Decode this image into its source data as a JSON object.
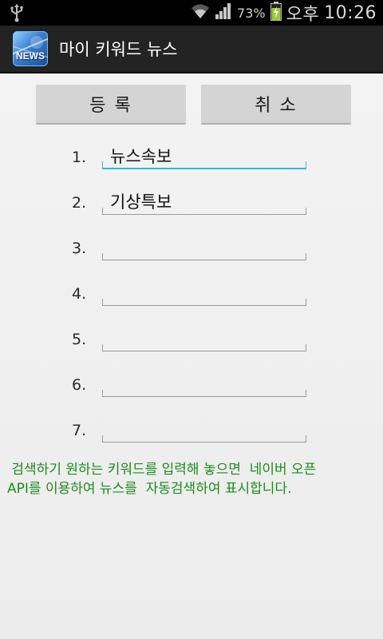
{
  "status_bar": {
    "battery_percent": "73%",
    "am_pm": "오후",
    "time": "10:26",
    "icons": [
      "usb-icon",
      "wifi-icon",
      "signal-icon",
      "battery-charging-icon"
    ]
  },
  "action_bar": {
    "app_icon_text": "NEWS",
    "title": "마이 키워드 뉴스"
  },
  "buttons": {
    "register": "등 록",
    "cancel": "취 소"
  },
  "keywords": [
    {
      "number": "1.",
      "value": "뉴스속보",
      "focused": true
    },
    {
      "number": "2.",
      "value": "기상특보",
      "focused": false
    },
    {
      "number": "3.",
      "value": "",
      "focused": false
    },
    {
      "number": "4.",
      "value": "",
      "focused": false
    },
    {
      "number": "5.",
      "value": "",
      "focused": false
    },
    {
      "number": "6.",
      "value": "",
      "focused": false
    },
    {
      "number": "7.",
      "value": "",
      "focused": false
    }
  ],
  "note": {
    "line1": " 검색하기 원하는 키워드를 입력해 놓으면  네이버 오픈",
    "line2": "API를 이용하여 뉴스를  자동검색하여 표시합니다."
  },
  "colors": {
    "accent_focus": "#33b5e5",
    "note_text": "#1d8b1d",
    "battery_green": "#9acd32"
  }
}
